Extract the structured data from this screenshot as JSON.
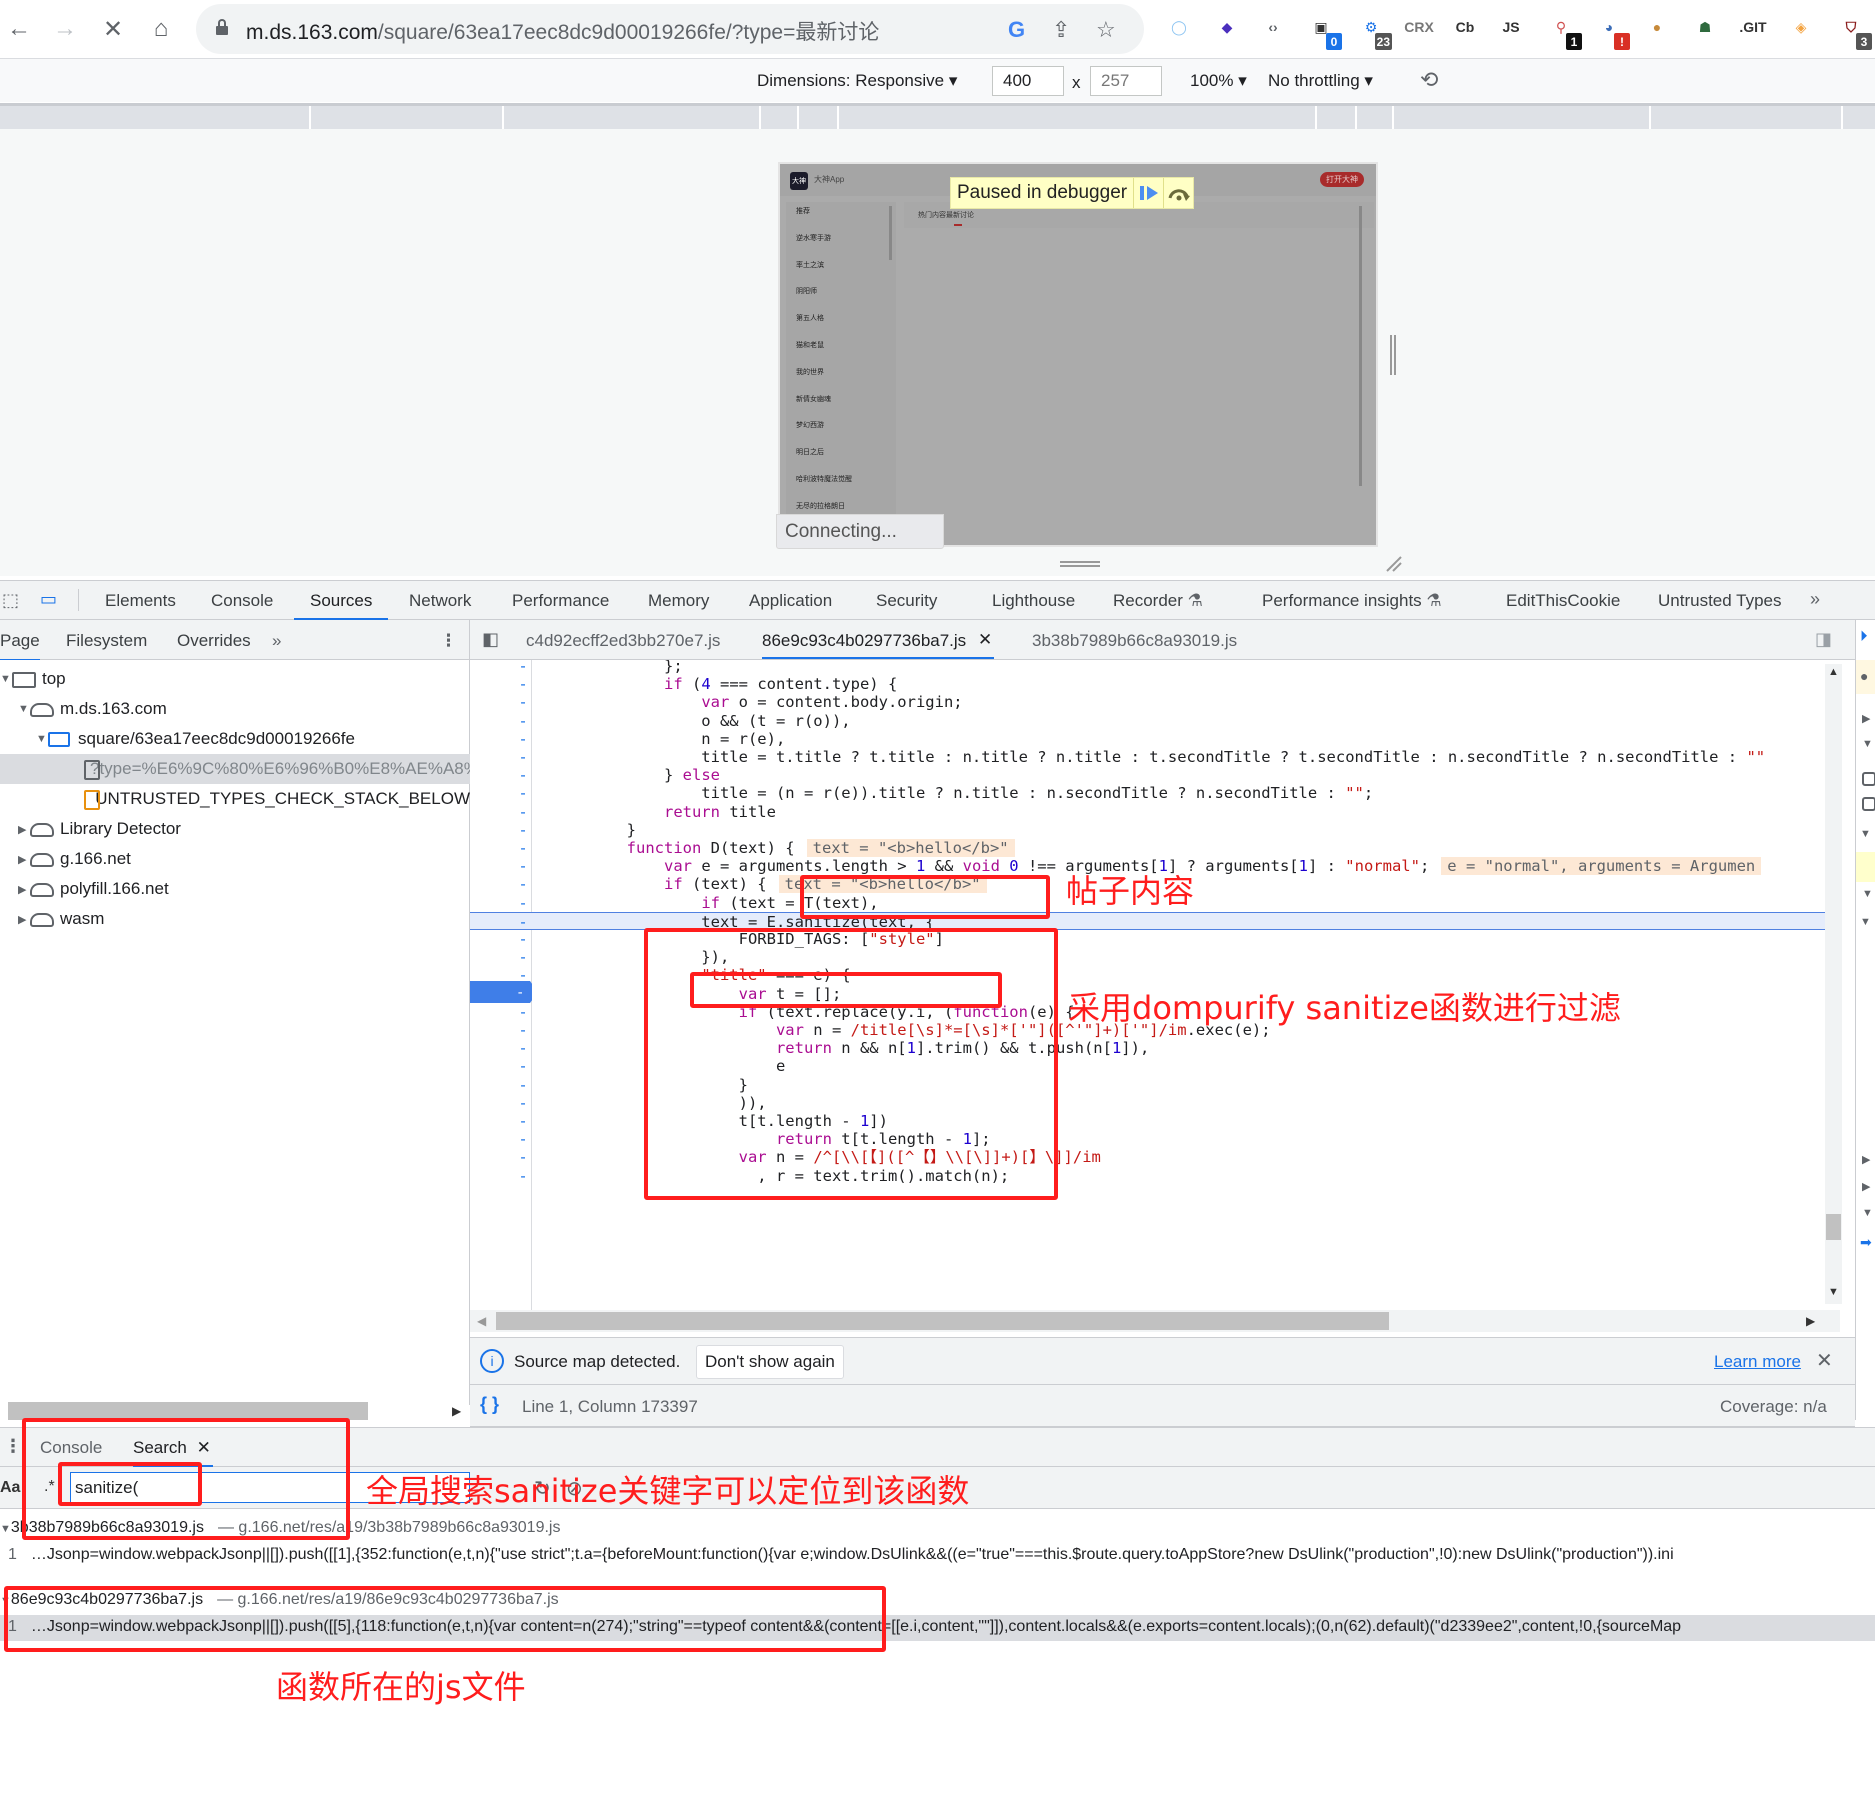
{
  "browser": {
    "url_host": "m.ds.163.com",
    "url_path": "/square/63ea17eec8dc9d00019266fe/?type=最新讨论",
    "extensions": [
      {
        "name": "extension-circle",
        "glyph": "◯",
        "badge": null
      },
      {
        "name": "extension-layers",
        "glyph": "◆",
        "badge": null
      },
      {
        "name": "extension-code",
        "glyph": "‹›",
        "badge": null
      },
      {
        "name": "extension-panda",
        "glyph": "▣",
        "badge": "0"
      },
      {
        "name": "extension-gear",
        "glyph": "⚙",
        "badge": "23"
      },
      {
        "name": "extension-crx",
        "glyph": "CRX",
        "badge": null
      },
      {
        "name": "extension-cb",
        "glyph": "Cb",
        "badge": null
      },
      {
        "name": "extension-js-search",
        "glyph": "JS",
        "badge": null
      },
      {
        "name": "extension-key",
        "glyph": "⚲",
        "badge": "1"
      },
      {
        "name": "extension-globe",
        "glyph": "◕",
        "badge": "!"
      },
      {
        "name": "extension-cookie",
        "glyph": "●",
        "badge": null
      },
      {
        "name": "extension-robot",
        "glyph": "☗",
        "badge": null
      },
      {
        "name": "extension-git",
        "glyph": ".GIT",
        "badge": null
      },
      {
        "name": "extension-orange",
        "glyph": "◈",
        "badge": null
      },
      {
        "name": "extension-ublock",
        "glyph": "⛉",
        "badge": "3"
      }
    ]
  },
  "device_toolbar": {
    "dimensions_label": "Dimensions: Responsive",
    "width": "400",
    "times": "x",
    "height": "257",
    "zoom": "100%",
    "throttling": "No throttling"
  },
  "device_page": {
    "app_name": "大神App",
    "app_logo": "大神",
    "open_button": "打开大神",
    "nav_items": [
      "推荐",
      "逆水寒手游",
      "率土之滨",
      "阴阳师",
      "第五人格",
      "猫和老鼠",
      "我的世界",
      "新倩女幽魂",
      "梦幻西游",
      "明日之后",
      "哈利波特魔法觉醒",
      "无尽的拉格朗日"
    ],
    "tabs": [
      "热门内容",
      "最新讨论"
    ],
    "paused_label": "Paused in debugger",
    "connecting": "Connecting..."
  },
  "devtools": {
    "tabs": [
      "Elements",
      "Console",
      "Sources",
      "Network",
      "Performance",
      "Memory",
      "Application",
      "Security",
      "Lighthouse",
      "Recorder",
      "Performance insights",
      "EditThisCookie",
      "Untrusted Types"
    ],
    "active_tab": "Sources",
    "sources_subtabs": [
      "Page",
      "Filesystem",
      "Overrides"
    ],
    "editor_tabs": [
      "c4d92ecff2ed3bb270e7.js",
      "86e9c93c4b0297736ba7.js",
      "3b38b7989b66c8a93019.js"
    ],
    "active_editor_tab": "86e9c93c4b0297736ba7.js",
    "tree": [
      {
        "label": "top",
        "type": "frame",
        "depth": 0,
        "expanded": true
      },
      {
        "label": "m.ds.163.com",
        "type": "cloud",
        "depth": 1,
        "expanded": true
      },
      {
        "label": "square/63ea17eec8dc9d00019266fe",
        "type": "folder",
        "depth": 2,
        "expanded": true
      },
      {
        "label": "?type=%E6%9C%80%E6%96%B0%E8%AE%A8%",
        "type": "file",
        "depth": 3,
        "selected": true
      },
      {
        "label": "UNTRUSTED_TYPES_CHECK_STACK_BELOW",
        "type": "file-orange",
        "depth": 3
      },
      {
        "label": "Library Detector",
        "type": "cloud",
        "depth": 1,
        "expanded": false
      },
      {
        "label": "g.166.net",
        "type": "cloud",
        "depth": 1,
        "expanded": false
      },
      {
        "label": "polyfill.166.net",
        "type": "cloud",
        "depth": 1,
        "expanded": false
      },
      {
        "label": "wasm",
        "type": "cloud",
        "depth": 1,
        "expanded": false
      }
    ],
    "code_lines": [
      "            };",
      "            if (4 === content.type) {",
      "                var o = content.body.origin;",
      "                o && (t = r(o)),",
      "                n = r(e),",
      "                title = t.title ? t.title : n.title ? n.title : t.secondTitle ? t.secondTitle : n.secondTitle ? n.secondTitle : \"\"",
      "            } else",
      "                title = (n = r(e)).title ? n.title : n.secondTitle ? n.secondTitle : \"\";",
      "            return title",
      "        }",
      "        function D(text) {",
      "            var e = arguments.length > 1 && void 0 !== arguments[1] ? arguments[1] : \"normal\";",
      "            if (text) {",
      "                if (text = T(text),",
      "                text = E.sanitize(text, {",
      "                    FORBID_TAGS: [\"style\"]",
      "                }),",
      "                \"title\" === e) {",
      "                    var t = [];",
      "                    if (text.replace(y.i, (function(e) {",
      "                        var n = /title[\\s]*=[\\s]*['\"]([^'\"]+)['\"]/im.exec(e);",
      "                        return n && n[1].trim() && t.push(n[1]),",
      "                        e",
      "                    }",
      "                    )),",
      "                    t[t.length - 1])",
      "                        return t[t.length - 1];",
      "                    var n = /^[\\\\[【]([^【】\\\\[\\]]+)[】\\]]/im",
      "                      , r = text.trim().match(n);"
    ],
    "inline_values": {
      "func_D": "text = \"<b>hello</b>\"",
      "var_e": "e = \"normal\", arguments = Argumen",
      "if_text": "text = \"<b>hello</b>\""
    },
    "gutter_marker": "-",
    "sourcemap_message": "Source map detected.",
    "dont_show_again": "Don't show again",
    "learn_more": "Learn more",
    "cursor_position": "Line 1, Column 173397",
    "coverage": "Coverage: n/a"
  },
  "drawer": {
    "tabs": [
      "Console",
      "Search"
    ],
    "active_tab": "Search",
    "match_case_label": "Aa",
    "regex_label": ".*",
    "search_value": "sanitize(",
    "results": [
      {
        "file": "3b38b7989b66c8a93019.js",
        "url": "g.166.net/res/a19/3b38b7989b66c8a93019.js",
        "line_no": "1",
        "snippet": "…Jsonp=window.webpackJsonp||[]).push([[1],{352:function(e,t,n){\"use strict\";t.a={beforeMount:function(){var e;window.DsUlink&&((e=\"true\"===this.$route.query.toAppStore?new DsUlink(\"production\",!0):new DsUlink(\"production\")).ini"
      },
      {
        "file": "86e9c93c4b0297736ba7.js",
        "url": "g.166.net/res/a19/86e9c93c4b0297736ba7.js",
        "line_no": "1",
        "snippet": "…Jsonp=window.webpackJsonp||[]).push([[5],{118:function(e,t,n){var content=n(274);\"string\"==typeof content&&(content=[[e.i,content,\"\"]]),content.locals&&(e.exports=content.locals);(0,n(62).default)(\"d2339ee2\",content,!0,{sourceMap"
      }
    ]
  },
  "annotations": {
    "post_content": "帖子内容",
    "sanitize_note": "采用dompurify sanitize函数进行过滤",
    "search_note": "全局搜索sanitize关键字可以定位到该函数",
    "file_note": "函数所在的js文件"
  }
}
